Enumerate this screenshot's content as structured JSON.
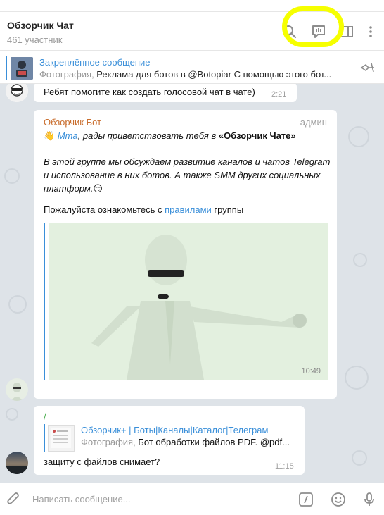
{
  "header": {
    "title": "Обзорчик Чат",
    "members": "461 участник"
  },
  "pinned": {
    "label": "Закреплённое сообщение",
    "kind": "Фотография,",
    "text": " Реклама для ботов в @Botopiar  С помощью этого бот..."
  },
  "messages": {
    "m1": {
      "text": "Ребят помогите как создать голосовой чат в чате)",
      "time": "2:21"
    },
    "m2": {
      "sender": "Обзорчик Бот",
      "role": "админ",
      "wave": "👋",
      "mention": "Mma",
      "greet": ", рады приветствовать тебя в ",
      "chat_name": "«Обзорчик Чате»",
      "para2": "В этой группе мы обсуждаем развитие каналов и чатов Telegram и использование в них ботов. А также SMM других социальных платформ.",
      "para2_emoji": "😏",
      "para3_prefix": "Пожалуйста ознакомьтесь с ",
      "para3_link": "правилами",
      "para3_suffix": " группы",
      "time": "10:49"
    },
    "m3": {
      "sender": "/",
      "reply_title": "Обзорчик+ | Боты|Каналы|Каталог|Телеграм",
      "reply_kind": "Фотография,",
      "reply_text": " Бот обработки файлов PDF.  @pdf...",
      "text": "защиту с файлов снимает?",
      "time": "11:15"
    }
  },
  "composer": {
    "placeholder": "Написать сообщение..."
  },
  "colors": {
    "accent": "#3a8fd9",
    "bot_name": "#c96e2e",
    "highlight": "#f6ff00",
    "chat_bg": "#dee3e8"
  }
}
